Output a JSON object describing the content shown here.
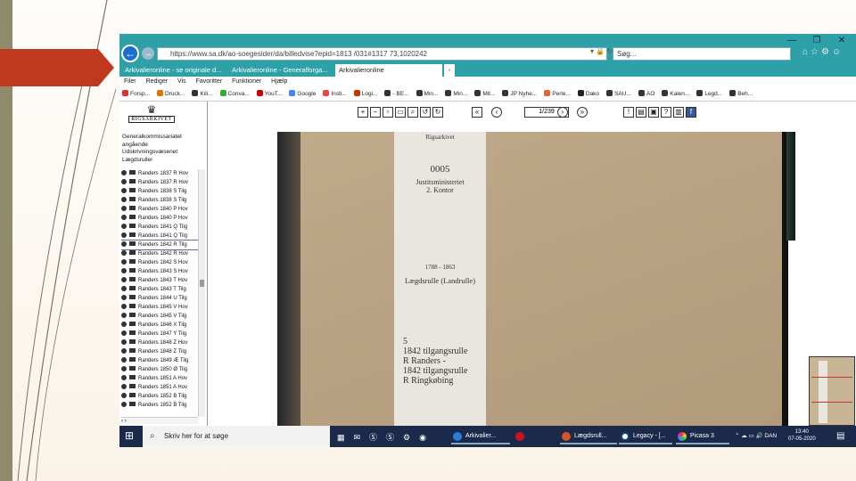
{
  "browser": {
    "url": "https://www.sa.dk/ao-soegesider/da/billedvise?epid=1813 /031#1317 73,1020242",
    "search": "Søg...",
    "tabs": [
      "Arkivalieronline - se originale d...",
      "Arkivalieronline - Generalforga...",
      "Arkivalieronline"
    ],
    "menu": [
      "Filer",
      "Rediger",
      "Vis",
      "Favoritter",
      "Funktioner",
      "Hjælp"
    ],
    "favorites": [
      "Forsp...",
      "Druck...",
      "Kili...",
      "Conva...",
      "YouT...",
      "Google",
      "Insti...",
      "Logi...",
      "- BE...",
      "Min...",
      "Min...",
      "Mit...",
      "JP Nyhe...",
      "Perle...",
      "Dako",
      "SAU...",
      "AO",
      "Kalen...",
      "Legd...",
      "Beh..."
    ]
  },
  "site": {
    "logo_text": "RIGSARKIVET",
    "page_value": "1/239"
  },
  "tree": {
    "heading": "Generalkommissariatet angående Udskrivningsvæsenet Lægdsruller",
    "items": [
      "Randers 1837 R Hov",
      "Randers 1837 R Hov",
      "Randers 1838 S Tilg",
      "Randers 1838 S Tilg",
      "Randers 1840 P Hov",
      "Randers 1840 P Hov",
      "Randers 1841 Q Tilg",
      "Randers 1841 Q Tilg",
      "Randers 1842 R Tilg",
      "Randers 1842 R Hov",
      "Randers 1842 S Hov",
      "Randers 1843 S Hov",
      "Randers 1843 T Hov",
      "Randers 1843 T Tilg",
      "Randers 1844 U Tilg",
      "Randers 1845 V Hov",
      "Randers 1845 V Tilg",
      "Randers 1846 X Tilg",
      "Randers 1847 Y Tilg",
      "Randers 1848 Z Hov",
      "Randers 1848 Z Tilg",
      "Randers 1849 Æ Tilg",
      "Randers 1850 Ø Tilg",
      "Randers 1851 A Hov",
      "Randers 1851 A Hov",
      "Randers 1852 B Tilg",
      "Randers 1852 B Tilg"
    ]
  },
  "document": {
    "header": "Rigsarkivet",
    "number": "0005",
    "line1": "Justitsministeriet",
    "line2": "2. Kontor",
    "years": "1788 - 1863",
    "title": "Lægdsrulle (Landrulle)",
    "vol": "5",
    "v1": "1842 tilgangsrulle",
    "v2": "R Randers -",
    "v3": "1842 tilgangsrulle",
    "v4": "R Ringkøbing"
  },
  "taskbar": {
    "search": "Skriv her for at søge",
    "apps": [
      "Arkivalier...",
      "Lægdsrull...",
      "Legacy - [...",
      "Picasa 3"
    ],
    "lang": "DAN",
    "time": "13:40",
    "date": "07-05-2020"
  }
}
